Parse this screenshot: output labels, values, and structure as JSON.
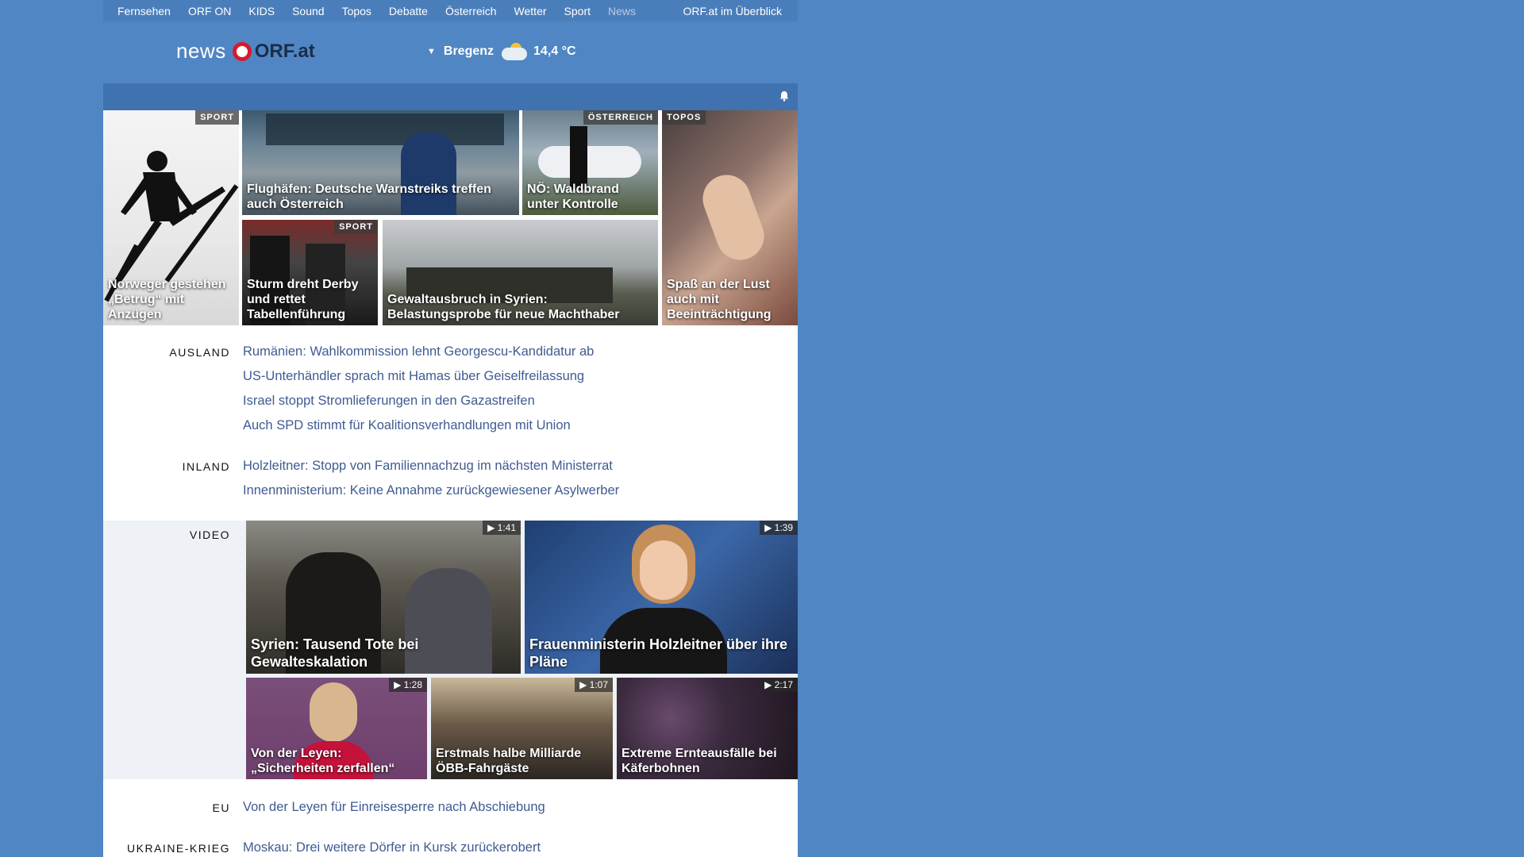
{
  "topnav": {
    "items": [
      "Fernsehen",
      "ORF ON",
      "KIDS",
      "Sound",
      "Topos",
      "Debatte",
      "Österreich",
      "Wetter",
      "Sport",
      "News"
    ],
    "active": "News",
    "overview": "ORF.at im Überblick"
  },
  "header": {
    "logo_news": "news",
    "logo_orf": "ORF.at",
    "weather": {
      "city": "Bregenz",
      "temp": "14,4 °C",
      "icon": "partly-cloudy-icon"
    }
  },
  "colors": {
    "background": "#5086c3",
    "nav": "#4a7ebb",
    "link": "#3f5b92",
    "orf_red": "#d61a2b"
  },
  "teasers": [
    {
      "tag": "SPORT",
      "caption": "Norweger gestehen „Betrug“ mit Anzügen"
    },
    {
      "tag": "",
      "caption": "Flughäfen: Deutsche Warnstreiks treffen auch Österreich"
    },
    {
      "tag": "ÖSTERREICH",
      "caption": "NÖ: Waldbrand unter Kontrolle"
    },
    {
      "tag": "TOPOS",
      "caption": "Spaß an der Lust auch mit Beeinträchtigung"
    },
    {
      "tag": "SPORT",
      "caption": "Sturm dreht Derby und rettet Tabellenführung"
    },
    {
      "tag": "",
      "caption": "Gewaltausbruch in Syrien: Belastungsprobe für neue Machthaber"
    }
  ],
  "sections": {
    "ausland": {
      "label": "AUSLAND",
      "links": [
        "Rumänien: Wahlkommission lehnt Georgescu-Kandidatur ab",
        "US-Unterhändler sprach mit Hamas über Geiselfreilassung",
        "Israel stoppt Stromlieferungen in den Gazastreifen",
        "Auch SPD stimmt für Koalitionsverhandlungen mit Union"
      ]
    },
    "inland": {
      "label": "INLAND",
      "links": [
        "Holzleitner: Stopp von Familiennachzug im nächsten Ministerrat",
        "Innenministerium: Keine Annahme zurückgewiesener Asylwerber"
      ]
    },
    "video": {
      "label": "VIDEO",
      "items": [
        {
          "caption": "Syrien: Tausend Tote bei Gewalteskalation",
          "duration": "1:41"
        },
        {
          "caption": "Frauenministerin Holzleitner über ihre Pläne",
          "duration": "1:39"
        },
        {
          "caption": "Von der Leyen: „Sicherheiten zerfallen“",
          "duration": "1:28"
        },
        {
          "caption": "Erstmals halbe Milliarde ÖBB-Fahrgäste",
          "duration": "1:07"
        },
        {
          "caption": "Extreme Ernteausfälle bei Käferbohnen",
          "duration": "2:17"
        }
      ]
    },
    "eu": {
      "label": "EU",
      "links": [
        "Von der Leyen für Einreisesperre nach Abschiebung"
      ]
    },
    "ukraine": {
      "label": "UKRAINE-KRIEG",
      "links": [
        "Moskau: Drei weitere Dörfer in Kursk zurückerobert"
      ]
    }
  }
}
